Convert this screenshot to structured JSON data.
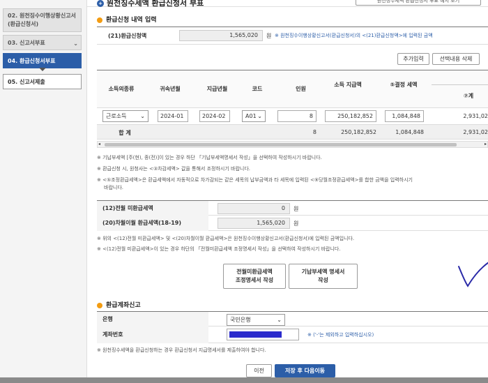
{
  "sidebar": {
    "items": [
      {
        "label": "02. 원천징수이행상황신고서(환급신청서)"
      },
      {
        "label": "03. 신고서부표"
      },
      {
        "label": "04. 환급신청서부표"
      },
      {
        "label": "05. 신고서제출"
      }
    ]
  },
  "header": {
    "title": "원천징수세액 환급신청서 부표",
    "top_button": "원천징수세액 환급신청서 부표 예시 보기"
  },
  "refund_section": {
    "title": "환급신청 내역 입력",
    "field_label": "(21)환급신청액",
    "field_value": "1,565,020",
    "unit": "원",
    "note": "※ 원천징수이행상황신고서(환급신청서)의 <(21)환급신청액>에 입력된 금액"
  },
  "table_buttons": {
    "add": "추가입력",
    "delete": "선택내용 삭제"
  },
  "table": {
    "headers": [
      "소득의종류",
      "귀속년월",
      "지급년월",
      "코드",
      "인원",
      "소득 지급액",
      "⑤결정 세액",
      "⑦계"
    ],
    "row": {
      "income_type": "근로소득",
      "attribution": "2024-01",
      "payment": "2024-02",
      "code": "A01",
      "persons": "8",
      "income_paid": "250,182,852",
      "tax": "1,084,848",
      "total": "2,931,02"
    },
    "sum": {
      "label": "합 계",
      "persons": "8",
      "income_paid": "250,182,852",
      "tax": "1,084,848",
      "total": "2,931,02"
    }
  },
  "notes1": [
    "※ 기납부세액 [주(현), 종(전)]이 있는 경우 하단 「기납부세액명세서 작성」을 선택하여 작성하시기 바랍니다.",
    "※ 환급신청 시, 원청사는 <③차감세액> 값을 통해서 조정하시기 바랍니다.",
    "※ <⑤조정환급세액>은 환급세액에서 자동적으로 차가감되는 같은 세목의 납부금액과 타 세목에 입력된 <⑨당월조정환급세액>를 합한 금액을 입력하시기",
    "바랍니다."
  ],
  "carry": {
    "label1": "(12)전월 미환급세액",
    "value1": "0",
    "label2": "(20)차월이월 환급세액(18-19)",
    "value2": "1,565,020",
    "unit": "원"
  },
  "notes2": [
    "※ 위의 <(12)전월 미환급세액> 및 <(20)차월이월 환급세액>은 원천징수이행상황신고서(환급신청서)에 입력된 금액입니다.",
    "※ <(12)전월 미환급세액>이 있는 경우 하단의 「전월미환급세액 조정명세서 작성」을 선택하여 작성하시기 바랍니다."
  ],
  "action_buttons": {
    "prev_refund_l1": "전월미환급세액",
    "prev_refund_l2": "조정명세서 작성",
    "paid_tax_l1": "기납부세액 명세서",
    "paid_tax_l2": "작성"
  },
  "account": {
    "title": "환급계좌신고",
    "bank_label": "은행",
    "bank_value": "국민은행",
    "account_label": "계좌번호",
    "account_hint": "※ ('-'는 제외하고 입력하십시오)",
    "note": "※ 원천징수세액을 환급신청하는 경우 환급신청서 지급명세서를 제출하여야 합니다."
  },
  "footer": {
    "prev": "이전",
    "next": "저장 후 다음이동"
  },
  "colors": {
    "primary": "#2c5ea8",
    "accent": "#f39c12"
  }
}
